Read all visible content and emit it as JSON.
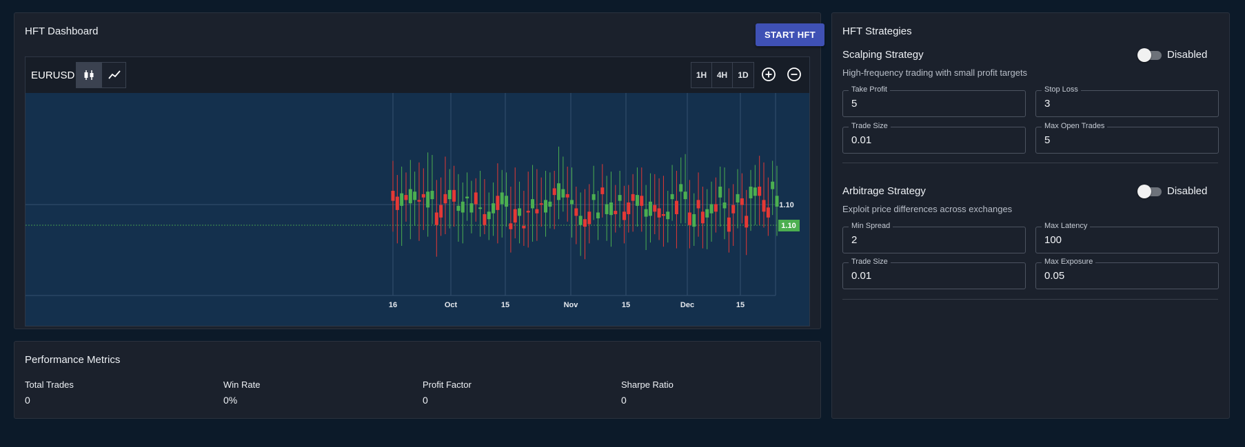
{
  "dashboard": {
    "title": "HFT Dashboard",
    "start_button": "START HFT"
  },
  "chart": {
    "symbol": "EURUSD",
    "chart_type_buttons": [
      "candlestick-icon",
      "line-chart-icon"
    ],
    "timeframes": [
      "1H",
      "4H",
      "1D"
    ],
    "zoom_buttons": [
      "zoom-in-icon",
      "zoom-out-icon"
    ],
    "price_label_upper": "1.10",
    "price_label_current": "1.10",
    "colors": {
      "up": "#4caf50",
      "down": "#e53935",
      "background": "#14304d",
      "grid": "#33506e"
    }
  },
  "chart_data": {
    "type": "candlestick",
    "title": "",
    "x_tick_labels": [
      "16",
      "Oct",
      "15",
      "Nov",
      "15",
      "Dec",
      "15"
    ],
    "y_tick_labels": [
      "1.10"
    ],
    "last_price": "1.10",
    "grid": true,
    "candles": [
      {
        "dir": "down",
        "o": 1.1024,
        "c": 1.1012,
        "h": 1.106,
        "l": 1.0975
      },
      {
        "dir": "down",
        "o": 1.1017,
        "c": 1.1001,
        "h": 1.1043,
        "l": 1.0961
      },
      {
        "dir": "up",
        "o": 1.1006,
        "c": 1.1021,
        "h": 1.1053,
        "l": 1.0958
      },
      {
        "dir": "down",
        "o": 1.1019,
        "c": 1.1013,
        "h": 1.1046,
        "l": 1.0987
      },
      {
        "dir": "up",
        "o": 1.1009,
        "c": 1.1026,
        "h": 1.1061,
        "l": 1.0966
      },
      {
        "dir": "up",
        "o": 1.1013,
        "c": 1.1023,
        "h": 1.1047,
        "l": 1.0982
      },
      {
        "dir": "down",
        "o": 1.1013,
        "c": 1.1011,
        "h": 1.1058,
        "l": 1.0964
      },
      {
        "dir": "down",
        "o": 1.102,
        "c": 1.1016,
        "h": 1.1051,
        "l": 1.0977
      },
      {
        "dir": "up",
        "o": 1.1004,
        "c": 1.1023,
        "h": 1.107,
        "l": 1.0969
      },
      {
        "dir": "up",
        "o": 1.1014,
        "c": 1.1024,
        "h": 1.1067,
        "l": 1.0984
      },
      {
        "dir": "down",
        "o": 1.0998,
        "c": 1.0983,
        "h": 1.1037,
        "l": 1.0945
      },
      {
        "dir": "down",
        "o": 1.1007,
        "c": 1.0992,
        "h": 1.104,
        "l": 1.097
      },
      {
        "dir": "down",
        "o": 1.102,
        "c": 1.1009,
        "h": 1.1065,
        "l": 1.0972
      },
      {
        "dir": "up",
        "o": 1.1014,
        "c": 1.1025,
        "h": 1.105,
        "l": 1.0979
      },
      {
        "dir": "down",
        "o": 1.1025,
        "c": 1.1011,
        "h": 1.1054,
        "l": 1.0981
      },
      {
        "dir": "up",
        "o": 1.1,
        "c": 1.1006,
        "h": 1.1044,
        "l": 1.0963
      },
      {
        "dir": "up",
        "o": 1.0998,
        "c": 1.1011,
        "h": 1.1034,
        "l": 1.0961
      },
      {
        "dir": "up",
        "o": 1.1015,
        "c": 1.1017,
        "h": 1.1046,
        "l": 1.0988
      },
      {
        "dir": "up",
        "o": 1.0998,
        "c": 1.1009,
        "h": 1.1036,
        "l": 1.0973
      },
      {
        "dir": "down",
        "o": 1.1022,
        "c": 1.1008,
        "h": 1.1039,
        "l": 1.0987
      },
      {
        "dir": "up",
        "o": 1.1003,
        "c": 1.1004,
        "h": 1.1048,
        "l": 1.0969
      },
      {
        "dir": "down",
        "o": 1.0996,
        "c": 1.0983,
        "h": 1.1038,
        "l": 1.0972
      },
      {
        "dir": "up",
        "o": 1.099,
        "c": 1.0999,
        "h": 1.1022,
        "l": 1.0965
      },
      {
        "dir": "up",
        "o": 1.0997,
        "c": 1.1009,
        "h": 1.1034,
        "l": 1.097
      },
      {
        "dir": "down",
        "o": 1.1018,
        "c": 1.1001,
        "h": 1.1057,
        "l": 1.0961
      },
      {
        "dir": "up",
        "o": 1.1008,
        "c": 1.1022,
        "h": 1.1049,
        "l": 1.0968
      },
      {
        "dir": "up",
        "o": 1.1005,
        "c": 1.1018,
        "h": 1.1046,
        "l": 1.0981
      },
      {
        "dir": "down",
        "o": 1.0985,
        "c": 1.0978,
        "h": 1.1029,
        "l": 1.095
      },
      {
        "dir": "down",
        "o": 1.1002,
        "c": 1.0986,
        "h": 1.1052,
        "l": 1.0967
      },
      {
        "dir": "up",
        "o": 1.0994,
        "c": 1.1003,
        "h": 1.1035,
        "l": 1.0961
      },
      {
        "dir": "down",
        "o": 1.0982,
        "c": 1.0979,
        "h": 1.1024,
        "l": 1.0958
      },
      {
        "dir": "down",
        "o": 1.1,
        "c": 1.0998,
        "h": 1.1047,
        "l": 1.0956
      },
      {
        "dir": "up",
        "o": 1.1003,
        "c": 1.1014,
        "h": 1.1055,
        "l": 1.0963
      },
      {
        "dir": "down",
        "o": 1.1002,
        "c": 1.0997,
        "h": 1.105,
        "l": 1.0964
      },
      {
        "dir": "down",
        "o": 1.1009,
        "c": 1.1008,
        "h": 1.104,
        "l": 1.0981
      },
      {
        "dir": "up",
        "o": 1.0998,
        "c": 1.1013,
        "h": 1.1048,
        "l": 1.0969
      },
      {
        "dir": "up",
        "o": 1.1005,
        "c": 1.1011,
        "h": 1.1046,
        "l": 1.0979
      },
      {
        "dir": "down",
        "o": 1.1027,
        "c": 1.1019,
        "h": 1.1048,
        "l": 1.0978
      },
      {
        "dir": "up",
        "o": 1.1013,
        "c": 1.1033,
        "h": 1.1077,
        "l": 1.099
      },
      {
        "dir": "up",
        "o": 1.1016,
        "c": 1.1026,
        "h": 1.1065,
        "l": 1.0999
      },
      {
        "dir": "down",
        "o": 1.102,
        "c": 1.1016,
        "h": 1.1053,
        "l": 1.0987
      },
      {
        "dir": "up",
        "o": 1.1008,
        "c": 1.1013,
        "h": 1.1052,
        "l": 1.0968
      },
      {
        "dir": "down",
        "o": 1.1003,
        "c": 1.0994,
        "h": 1.1029,
        "l": 1.096
      },
      {
        "dir": "up",
        "o": 1.0983,
        "c": 1.0994,
        "h": 1.1022,
        "l": 1.0946
      },
      {
        "dir": "down",
        "o": 1.099,
        "c": 1.0981,
        "h": 1.1026,
        "l": 1.0942
      },
      {
        "dir": "down",
        "o": 1.0999,
        "c": 1.0984,
        "h": 1.1032,
        "l": 1.0961
      },
      {
        "dir": "up",
        "o": 1.1013,
        "c": 1.102,
        "h": 1.1054,
        "l": 1.0989
      },
      {
        "dir": "up",
        "o": 1.0991,
        "c": 1.0998,
        "h": 1.1024,
        "l": 1.0965
      },
      {
        "dir": "down",
        "o": 1.1028,
        "c": 1.102,
        "h": 1.1056,
        "l": 1.0992
      },
      {
        "dir": "up",
        "o": 1.0996,
        "c": 1.1008,
        "h": 1.1042,
        "l": 1.0964
      },
      {
        "dir": "up",
        "o": 1.0995,
        "c": 1.101,
        "h": 1.1047,
        "l": 1.0957
      },
      {
        "dir": "down",
        "o": 1.1,
        "c": 1.0996,
        "h": 1.1031,
        "l": 1.0974
      },
      {
        "dir": "up",
        "o": 1.1012,
        "c": 1.1019,
        "h": 1.1048,
        "l": 1.098
      },
      {
        "dir": "down",
        "o": 1.0999,
        "c": 1.0989,
        "h": 1.103,
        "l": 1.0961
      },
      {
        "dir": "down",
        "o": 1.101,
        "c": 1.0996,
        "h": 1.1031,
        "l": 1.0974
      },
      {
        "dir": "down",
        "o": 1.102,
        "c": 1.1012,
        "h": 1.1044,
        "l": 1.0975
      },
      {
        "dir": "up",
        "o": 1.1006,
        "c": 1.1019,
        "h": 1.1052,
        "l": 1.0981
      },
      {
        "dir": "down",
        "o": 1.1018,
        "c": 1.1006,
        "h": 1.1052,
        "l": 1.0975
      },
      {
        "dir": "up",
        "o": 1.0993,
        "c": 1.1002,
        "h": 1.1031,
        "l": 1.0953
      },
      {
        "dir": "up",
        "o": 1.0994,
        "c": 1.1011,
        "h": 1.1045,
        "l": 1.0962
      },
      {
        "dir": "down",
        "o": 1.1007,
        "c": 1.0999,
        "h": 1.1044,
        "l": 1.0972
      },
      {
        "dir": "down",
        "o": 1.1003,
        "c": 1.0992,
        "h": 1.1039,
        "l": 1.0965
      },
      {
        "dir": "down",
        "o": 1.0996,
        "c": 1.0994,
        "h": 1.1042,
        "l": 1.0957
      },
      {
        "dir": "up",
        "o": 1.099,
        "c": 1.0999,
        "h": 1.1024,
        "l": 1.0962
      },
      {
        "dir": "up",
        "o": 1.1014,
        "c": 1.102,
        "h": 1.1055,
        "l": 1.0988
      },
      {
        "dir": "down",
        "o": 1.1012,
        "c": 1.0996,
        "h": 1.1048,
        "l": 1.0955
      },
      {
        "dir": "up",
        "o": 1.1023,
        "c": 1.1032,
        "h": 1.1064,
        "l": 1.0985
      },
      {
        "dir": "up",
        "o": 1.1014,
        "c": 1.1023,
        "h": 1.1068,
        "l": 1.0985
      },
      {
        "dir": "down",
        "o": 1.0998,
        "c": 1.0983,
        "h": 1.1037,
        "l": 1.0955
      },
      {
        "dir": "up",
        "o": 1.0981,
        "c": 1.0996,
        "h": 1.1021,
        "l": 1.0958
      },
      {
        "dir": "down",
        "o": 1.1013,
        "c": 1.1003,
        "h": 1.1046,
        "l": 1.0969
      },
      {
        "dir": "down",
        "o": 1.0999,
        "c": 1.0985,
        "h": 1.1029,
        "l": 1.0955
      },
      {
        "dir": "up",
        "o": 1.0992,
        "c": 1.1002,
        "h": 1.1026,
        "l": 1.0954
      },
      {
        "dir": "up",
        "o": 1.0997,
        "c": 1.1008,
        "h": 1.1035,
        "l": 1.0963
      },
      {
        "dir": "down",
        "o": 1.1008,
        "c": 1.0999,
        "h": 1.104,
        "l": 1.0974
      },
      {
        "dir": "up",
        "o": 1.1016,
        "c": 1.1029,
        "h": 1.1053,
        "l": 1.0981
      },
      {
        "dir": "up",
        "o": 1.1003,
        "c": 1.101,
        "h": 1.1052,
        "l": 1.0966
      },
      {
        "dir": "down",
        "o": 1.0992,
        "c": 1.0975,
        "h": 1.1027,
        "l": 1.095
      },
      {
        "dir": "down",
        "o": 1.1007,
        "c": 1.0997,
        "h": 1.1032,
        "l": 1.0958
      },
      {
        "dir": "up",
        "o": 1.101,
        "c": 1.102,
        "h": 1.105,
        "l": 1.0979
      },
      {
        "dir": "down",
        "o": 1.1015,
        "c": 1.1007,
        "h": 1.1045,
        "l": 1.0985
      },
      {
        "dir": "down",
        "o": 1.0994,
        "c": 1.098,
        "h": 1.1025,
        "l": 1.0947
      },
      {
        "dir": "up",
        "o": 1.1015,
        "c": 1.1029,
        "h": 1.1049,
        "l": 1.0976
      },
      {
        "dir": "up",
        "o": 1.1018,
        "c": 1.1028,
        "h": 1.1055,
        "l": 1.0983
      },
      {
        "dir": "down",
        "o": 1.1029,
        "c": 1.1018,
        "h": 1.1066,
        "l": 1.0983
      },
      {
        "dir": "down",
        "o": 1.1013,
        "c": 1.0999,
        "h": 1.1058,
        "l": 1.098
      },
      {
        "dir": "down",
        "o": 1.1004,
        "c": 1.0992,
        "h": 1.104,
        "l": 1.097
      },
      {
        "dir": "up",
        "o": 1.1026,
        "c": 1.1035,
        "h": 1.106,
        "l": 1.0995
      },
      {
        "dir": "up",
        "o": 1.1005,
        "c": 1.1018,
        "h": 1.1054,
        "l": 1.097
      }
    ]
  },
  "performance": {
    "title": "Performance Metrics",
    "metrics": [
      {
        "label": "Total Trades",
        "value": "0"
      },
      {
        "label": "Win Rate",
        "value": "0%"
      },
      {
        "label": "Profit Factor",
        "value": "0"
      },
      {
        "label": "Sharpe Ratio",
        "value": "0"
      }
    ]
  },
  "strategies": {
    "title": "HFT Strategies",
    "scalping": {
      "name": "Scalping Strategy",
      "status": "Disabled",
      "enabled": false,
      "description": "High-frequency trading with small profit targets",
      "fields": {
        "take_profit": {
          "label": "Take Profit",
          "value": "5"
        },
        "stop_loss": {
          "label": "Stop Loss",
          "value": "3"
        },
        "trade_size": {
          "label": "Trade Size",
          "value": "0.01"
        },
        "max_open_trades": {
          "label": "Max Open Trades",
          "value": "5"
        }
      }
    },
    "arbitrage": {
      "name": "Arbitrage Strategy",
      "status": "Disabled",
      "enabled": false,
      "description": "Exploit price differences across exchanges",
      "fields": {
        "min_spread": {
          "label": "Min Spread",
          "value": "2"
        },
        "max_latency": {
          "label": "Max Latency",
          "value": "100"
        },
        "trade_size": {
          "label": "Trade Size",
          "value": "0.01"
        },
        "max_exposure": {
          "label": "Max Exposure",
          "value": "0.05"
        }
      }
    }
  }
}
